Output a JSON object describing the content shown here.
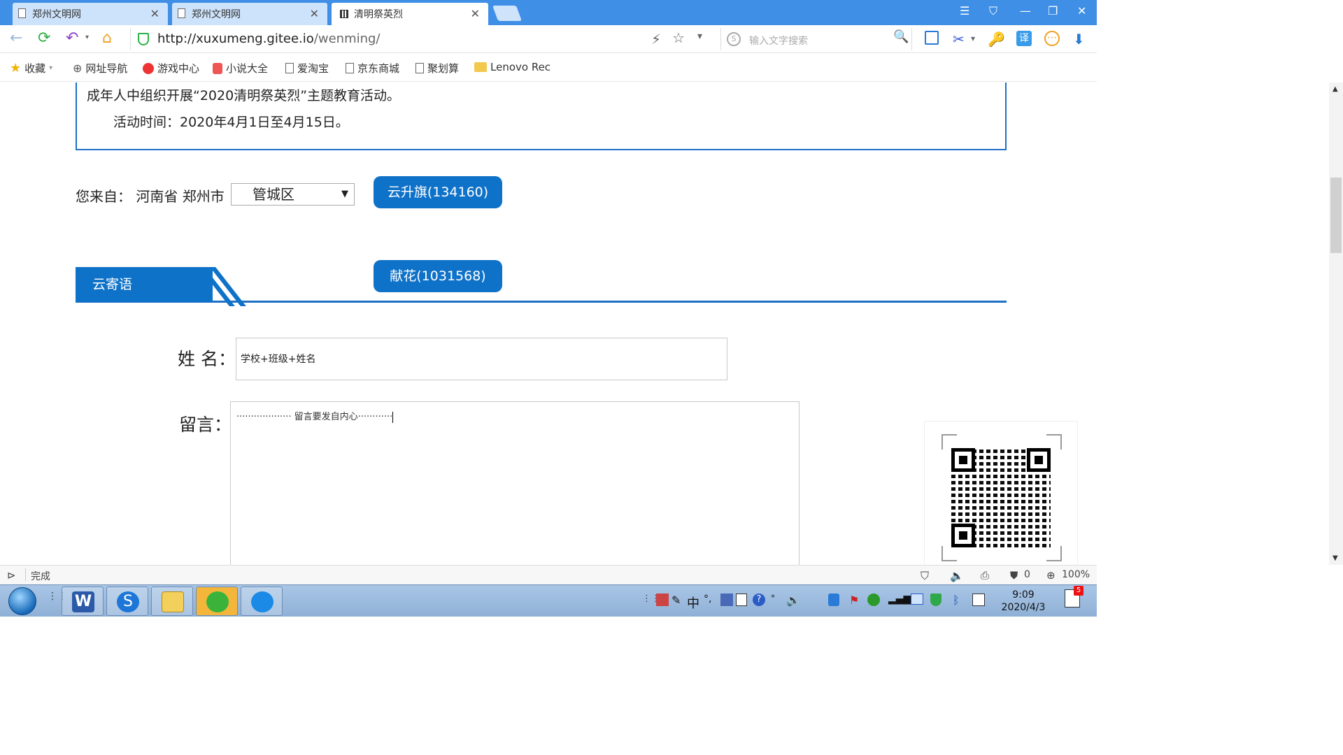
{
  "tabs": [
    {
      "title": "郑州文明网",
      "close": "✕"
    },
    {
      "title": "郑州文明网",
      "close": "✕"
    },
    {
      "title": "清明祭英烈",
      "close": "✕"
    }
  ],
  "window_controls": {
    "menu": "☰",
    "shirt": "⛉",
    "minimize": "—",
    "restore": "❐",
    "close": "✕"
  },
  "address": {
    "url_host": "http://xuxumeng.gitee.io",
    "url_path": "/wenming/"
  },
  "search": {
    "placeholder": "输入文字搜索",
    "logo": "S"
  },
  "toolbar_icons": {
    "lightning": "⚡",
    "star": "☆",
    "dropdown": "▾",
    "search": "🔍",
    "scissors": "✂",
    "key": "🔑",
    "translate": "译",
    "more": "⋯",
    "download": "⬇"
  },
  "bookmarks": [
    {
      "label": "收藏"
    },
    {
      "label": "网址导航"
    },
    {
      "label": "游戏中心"
    },
    {
      "label": "小说大全"
    },
    {
      "label": "爱淘宝"
    },
    {
      "label": "京东商城"
    },
    {
      "label": "聚划算"
    },
    {
      "label": "Lenovo Rec"
    }
  ],
  "notice": {
    "line1": "成年人中组织开展“2020清明祭英烈”主题教育活动。",
    "line2": "活动时间：2020年4月1日至4月15日。"
  },
  "origin": {
    "label": "您来自： 河南省 郑州市",
    "district": "管城区",
    "arrow": "▼"
  },
  "buttons": {
    "flag": "云升旗(134160)",
    "flowers": "献花(1031568)"
  },
  "section": {
    "title": "云寄语"
  },
  "form": {
    "name_label": "姓 名：",
    "name_value": "学校+班级+姓名",
    "message_label": "留言：",
    "message_value": "···················  留言要发自内心············"
  },
  "status": {
    "text": "完成",
    "blocked": "0",
    "zoom": "100%"
  },
  "taskbar": {
    "ime": "中",
    "time": "9:09",
    "date": "2020/4/3",
    "notifications": "5"
  }
}
